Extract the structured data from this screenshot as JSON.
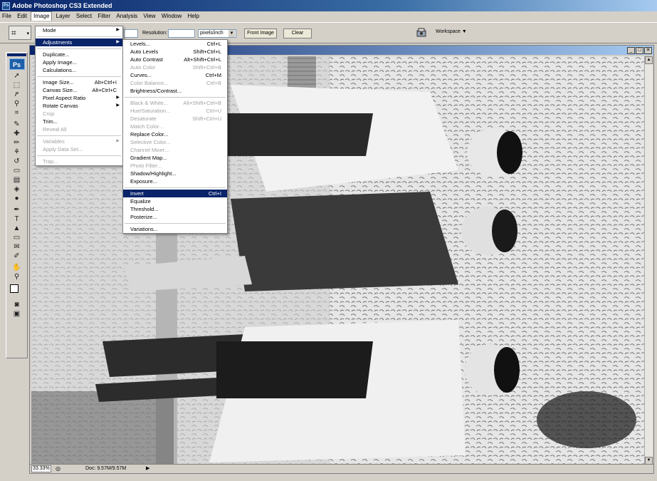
{
  "app": {
    "title": "Adobe Photoshop CS3 Extended",
    "icon": "ps-icon"
  },
  "menubar": [
    "File",
    "Edit",
    "Image",
    "Layer",
    "Select",
    "Filter",
    "Analysis",
    "View",
    "Window",
    "Help"
  ],
  "options_bar": {
    "tool_icon": "crop-icon",
    "resolution_label": "Resolution:",
    "resolution_value": "",
    "unit": "pixels/inch",
    "front_image_label": "Front Image",
    "clear_label": "Clear",
    "workspace_label": "Workspace ▼"
  },
  "toolbox": {
    "logo": "Ps",
    "tools": [
      {
        "name": "move-tool-icon",
        "glyph": "➚"
      },
      {
        "name": "marquee-tool-icon",
        "glyph": "⬚"
      },
      {
        "name": "lasso-tool-icon",
        "glyph": "ዖ"
      },
      {
        "name": "magic-wand-tool-icon",
        "glyph": "⚲"
      },
      {
        "name": "crop-tool-icon",
        "glyph": "⌗"
      },
      {
        "name": "slice-tool-icon",
        "glyph": "✎"
      },
      {
        "name": "healing-brush-tool-icon",
        "glyph": "✚"
      },
      {
        "name": "brush-tool-icon",
        "glyph": "✏"
      },
      {
        "name": "clone-stamp-tool-icon",
        "glyph": "⚘"
      },
      {
        "name": "history-brush-tool-icon",
        "glyph": "↺"
      },
      {
        "name": "eraser-tool-icon",
        "glyph": "▭"
      },
      {
        "name": "gradient-tool-icon",
        "glyph": "▤"
      },
      {
        "name": "blur-tool-icon",
        "glyph": "◈"
      },
      {
        "name": "dodge-tool-icon",
        "glyph": "●"
      },
      {
        "name": "pen-tool-icon",
        "glyph": "✒"
      },
      {
        "name": "type-tool-icon",
        "glyph": "T"
      },
      {
        "name": "path-selection-tool-icon",
        "glyph": "▲"
      },
      {
        "name": "shape-tool-icon",
        "glyph": "▭"
      },
      {
        "name": "notes-tool-icon",
        "glyph": "✉"
      },
      {
        "name": "eyedropper-tool-icon",
        "glyph": "✐"
      },
      {
        "name": "hand-tool-icon",
        "glyph": "✋"
      },
      {
        "name": "zoom-tool-icon",
        "glyph": "⚲"
      }
    ],
    "mode_icons": [
      {
        "name": "quick-mask-icon",
        "glyph": "◙"
      },
      {
        "name": "screen-mode-icon",
        "glyph": "▣"
      }
    ]
  },
  "document": {
    "zoom": "33.33%",
    "doc_info": "Doc: 9.57M/9.57M"
  },
  "image_menu": [
    {
      "label": "Mode",
      "shortcut": "",
      "submenu": true,
      "disabled": false
    },
    {
      "sep": true
    },
    {
      "label": "Adjustments",
      "shortcut": "",
      "submenu": true,
      "disabled": false,
      "highlight": true
    },
    {
      "sep": true
    },
    {
      "label": "Duplicate...",
      "shortcut": "",
      "disabled": false
    },
    {
      "label": "Apply Image...",
      "shortcut": "",
      "disabled": false
    },
    {
      "label": "Calculations...",
      "shortcut": "",
      "disabled": false
    },
    {
      "sep": true
    },
    {
      "label": "Image Size...",
      "shortcut": "Alt+Ctrl+I",
      "disabled": false
    },
    {
      "label": "Canvas Size...",
      "shortcut": "Alt+Ctrl+C",
      "disabled": false
    },
    {
      "label": "Pixel Aspect Ratio",
      "shortcut": "",
      "submenu": true,
      "disabled": false
    },
    {
      "label": "Rotate Canvas",
      "shortcut": "",
      "submenu": true,
      "disabled": false
    },
    {
      "label": "Crop",
      "shortcut": "",
      "disabled": true
    },
    {
      "label": "Trim...",
      "shortcut": "",
      "disabled": false
    },
    {
      "label": "Reveal All",
      "shortcut": "",
      "disabled": true
    },
    {
      "sep": true
    },
    {
      "label": "Variables",
      "shortcut": "",
      "submenu": true,
      "disabled": true
    },
    {
      "label": "Apply Data Set...",
      "shortcut": "",
      "disabled": true
    },
    {
      "sep": true
    },
    {
      "label": "Trap...",
      "shortcut": "",
      "disabled": true
    }
  ],
  "adjustments_menu": [
    {
      "label": "Levels...",
      "shortcut": "Ctrl+L",
      "disabled": false
    },
    {
      "label": "Auto Levels",
      "shortcut": "Shift+Ctrl+L",
      "disabled": false
    },
    {
      "label": "Auto Contrast",
      "shortcut": "Alt+Shift+Ctrl+L",
      "disabled": false
    },
    {
      "label": "Auto Color",
      "shortcut": "Shift+Ctrl+B",
      "disabled": true
    },
    {
      "label": "Curves...",
      "shortcut": "Ctrl+M",
      "disabled": false
    },
    {
      "label": "Color Balance...",
      "shortcut": "Ctrl+B",
      "disabled": true
    },
    {
      "label": "Brightness/Contrast...",
      "shortcut": "",
      "disabled": false
    },
    {
      "sep": true
    },
    {
      "label": "Black & White...",
      "shortcut": "Alt+Shift+Ctrl+B",
      "disabled": true
    },
    {
      "label": "Hue/Saturation...",
      "shortcut": "Ctrl+U",
      "disabled": true
    },
    {
      "label": "Desaturate",
      "shortcut": "Shift+Ctrl+U",
      "disabled": true
    },
    {
      "label": "Match Color...",
      "shortcut": "",
      "disabled": true
    },
    {
      "label": "Replace Color...",
      "shortcut": "",
      "disabled": false
    },
    {
      "label": "Selective Color...",
      "shortcut": "",
      "disabled": true
    },
    {
      "label": "Channel Mixer...",
      "shortcut": "",
      "disabled": true
    },
    {
      "label": "Gradient Map...",
      "shortcut": "",
      "disabled": false
    },
    {
      "label": "Photo Filter...",
      "shortcut": "",
      "disabled": true
    },
    {
      "label": "Shadow/Highlight...",
      "shortcut": "",
      "disabled": false
    },
    {
      "label": "Exposure...",
      "shortcut": "",
      "disabled": false
    },
    {
      "sep": true
    },
    {
      "label": "Invert",
      "shortcut": "Ctrl+I",
      "disabled": false,
      "highlight": true
    },
    {
      "label": "Equalize",
      "shortcut": "",
      "disabled": false
    },
    {
      "label": "Threshold...",
      "shortcut": "",
      "disabled": false
    },
    {
      "label": "Posterize...",
      "shortcut": "",
      "disabled": false
    },
    {
      "sep": true
    },
    {
      "label": "Variations...",
      "shortcut": "",
      "disabled": false
    }
  ],
  "colors": {
    "highlight": "#0a246a",
    "chrome": "#d4d0c8",
    "disabled_text": "#a0a0a0"
  }
}
